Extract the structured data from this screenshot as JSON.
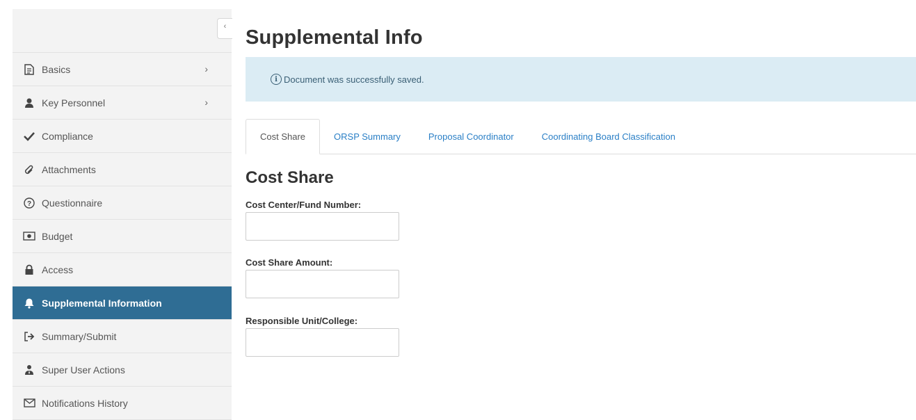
{
  "sidebar": {
    "collapse_glyph": "‹",
    "items": [
      {
        "label": "Basics",
        "icon": "document-icon",
        "has_chevron": true
      },
      {
        "label": "Key Personnel",
        "icon": "user-icon",
        "has_chevron": true
      },
      {
        "label": "Compliance",
        "icon": "check-icon",
        "has_chevron": false
      },
      {
        "label": "Attachments",
        "icon": "paperclip-icon",
        "has_chevron": false
      },
      {
        "label": "Questionnaire",
        "icon": "question-circle-icon",
        "has_chevron": false
      },
      {
        "label": "Budget",
        "icon": "money-icon",
        "has_chevron": false
      },
      {
        "label": "Access",
        "icon": "lock-icon",
        "has_chevron": false
      },
      {
        "label": "Supplemental Information",
        "icon": "bell-icon",
        "has_chevron": false,
        "active": true
      },
      {
        "label": "Summary/Submit",
        "icon": "sign-in-icon",
        "has_chevron": false
      },
      {
        "label": "Super User Actions",
        "icon": "user-tie-icon",
        "has_chevron": false
      },
      {
        "label": "Notifications History",
        "icon": "envelope-icon",
        "has_chevron": false
      }
    ],
    "chevron_glyph": "›",
    "active_color": "#2f6d94"
  },
  "main": {
    "title": "Supplemental Info",
    "alert": {
      "icon_glyph": "i",
      "message": "Document was successfully saved."
    },
    "tabs": [
      {
        "label": "Cost Share",
        "active": true
      },
      {
        "label": "ORSP Summary"
      },
      {
        "label": "Proposal Coordinator"
      },
      {
        "label": "Coordinating Board Classification"
      }
    ],
    "section_title": "Cost Share",
    "fields": [
      {
        "label": "Cost Center/Fund Number:",
        "value": ""
      },
      {
        "label": "Cost Share Amount:",
        "value": ""
      },
      {
        "label": "Responsible Unit/College:",
        "value": ""
      }
    ]
  },
  "colors": {
    "link": "#2a7fc6",
    "alert_bg": "#dbecf4",
    "sidebar_bg": "#f3f3f3"
  }
}
